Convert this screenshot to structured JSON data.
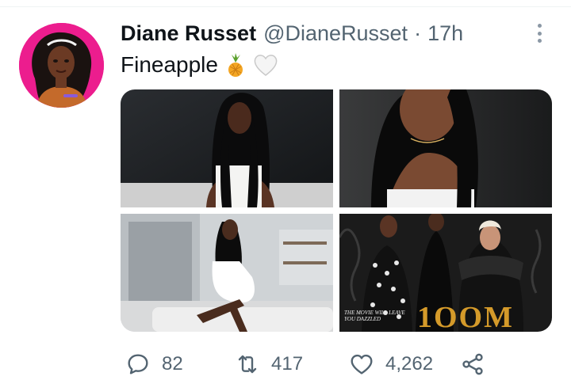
{
  "tweet": {
    "author_name": "Diane Russet",
    "handle": "@DianeRusset",
    "separator": "·",
    "time": "17h",
    "text": "Fineapple",
    "emojis": [
      "pineapple-emoji",
      "white-heart-emoji"
    ],
    "photo_captions": {
      "photo4_headline": "1OOM",
      "photo4_subtitle": "THE MOVIE WILL LEAVE YOU DAZZLED"
    }
  },
  "actions": {
    "reply_count": "82",
    "retweet_count": "417",
    "like_count": "4,262"
  },
  "icons": {
    "reply": "speech-bubble-icon",
    "retweet": "retweet-arrows-icon",
    "like": "heart-outline-icon",
    "share": "share-nodes-icon",
    "more": "vertical-dots-icon"
  },
  "colors": {
    "text_primary": "#0f1419",
    "text_secondary": "#536471",
    "avatar_bg": "#ec1d8e"
  }
}
